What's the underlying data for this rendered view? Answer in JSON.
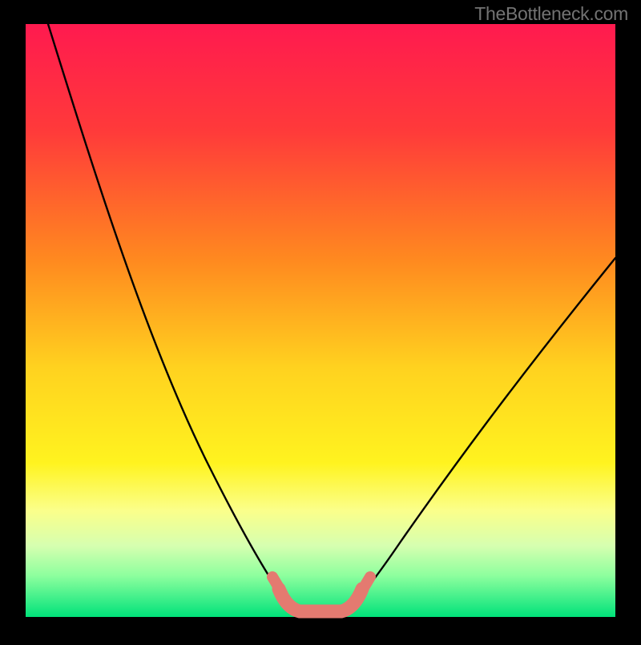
{
  "watermark": "TheBottleneck.com",
  "chart_data": {
    "type": "line",
    "title": "",
    "xlabel": "",
    "ylabel": "",
    "xlim": [
      0,
      100
    ],
    "ylim": [
      0,
      100
    ],
    "grid": false,
    "legend": false,
    "background_gradient_stops": [
      {
        "offset": 0.0,
        "color": "#ff1a4f"
      },
      {
        "offset": 0.18,
        "color": "#ff3a3a"
      },
      {
        "offset": 0.4,
        "color": "#ff8a1f"
      },
      {
        "offset": 0.58,
        "color": "#ffd21f"
      },
      {
        "offset": 0.74,
        "color": "#fff31f"
      },
      {
        "offset": 0.82,
        "color": "#fbff8a"
      },
      {
        "offset": 0.88,
        "color": "#d6ffb0"
      },
      {
        "offset": 0.93,
        "color": "#8eff9e"
      },
      {
        "offset": 1.0,
        "color": "#00e27a"
      }
    ],
    "series": [
      {
        "name": "left-curve",
        "stroke": "#000000",
        "x": [
          4.0,
          8.0,
          12.0,
          16.0,
          20.0,
          24.0,
          28.0,
          32.0,
          36.0,
          40.0,
          42.0,
          44.0
        ],
        "y": [
          100.0,
          88.0,
          76.0,
          64.0,
          52.0,
          40.0,
          29.0,
          20.0,
          12.5,
          6.5,
          4.0,
          2.5
        ]
      },
      {
        "name": "right-curve",
        "stroke": "#000000",
        "x": [
          55.0,
          58.0,
          62.0,
          66.0,
          70.0,
          75.0,
          80.0,
          85.0,
          90.0,
          95.0,
          100.0
        ],
        "y": [
          2.5,
          5.0,
          9.0,
          14.0,
          20.0,
          28.0,
          36.0,
          43.0,
          50.0,
          56.0,
          61.0
        ]
      },
      {
        "name": "valley-floor",
        "stroke": "#e47a70",
        "x": [
          42.0,
          44.0,
          46.0,
          48.0,
          50.0,
          52.0,
          54.0,
          55.0,
          57.0
        ],
        "y": [
          4.0,
          2.2,
          1.3,
          1.0,
          1.0,
          1.0,
          1.3,
          2.2,
          4.0
        ]
      }
    ],
    "annotations": []
  }
}
